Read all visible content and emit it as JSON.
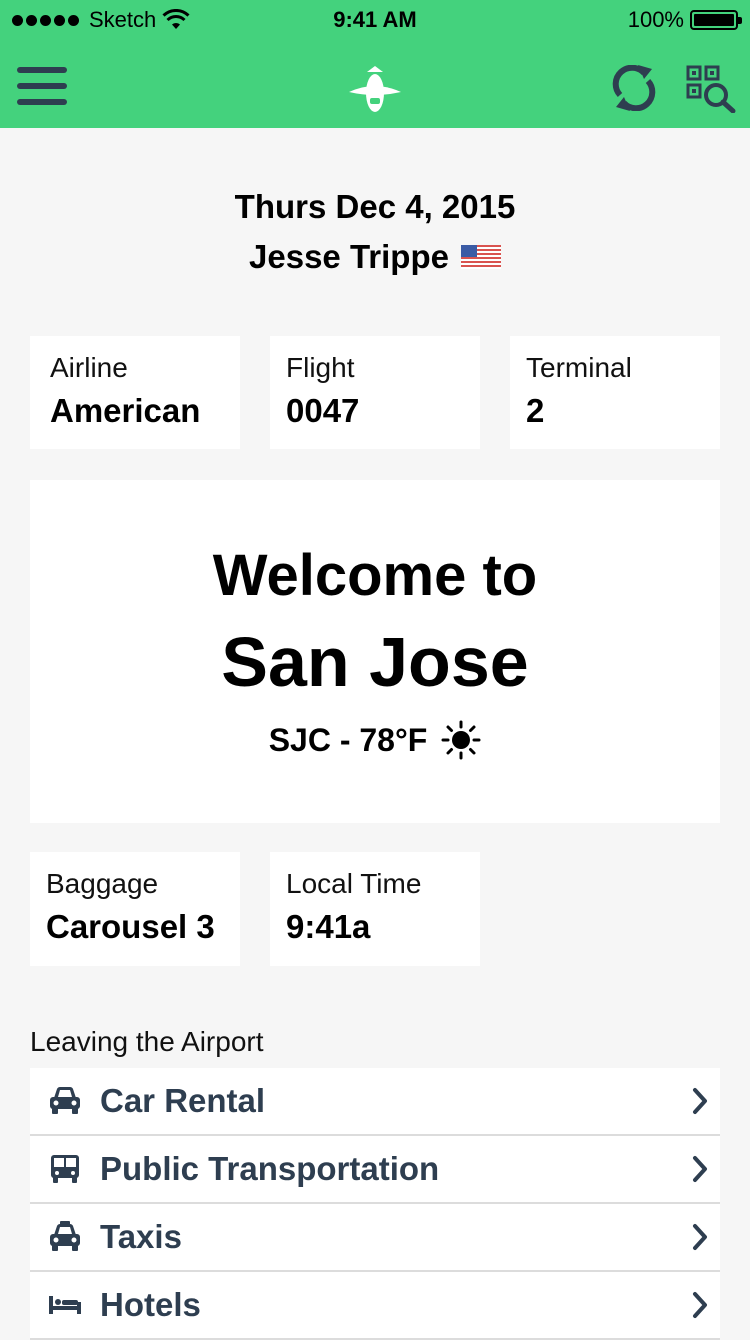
{
  "status_bar": {
    "carrier": "Sketch",
    "time": "9:41 AM",
    "battery_percent": "100%"
  },
  "navbar": {
    "menu_icon": "hamburger-icon",
    "logo_icon": "plane-icon",
    "refresh_icon": "refresh-icon",
    "scan_icon": "qr-search-icon"
  },
  "header": {
    "date": "Thurs Dec 4, 2015",
    "name": "Jesse Trippe",
    "flag": "us-flag"
  },
  "flight_info": [
    {
      "label": "Airline",
      "value": "American"
    },
    {
      "label": "Flight",
      "value": "0047"
    },
    {
      "label": "Terminal",
      "value": "2"
    }
  ],
  "welcome": {
    "line1": "Welcome to",
    "city": "San Jose",
    "weather": "SJC - 78°F",
    "weather_icon": "sun-icon"
  },
  "arrival_info": [
    {
      "label": "Baggage",
      "value": "Carousel 3"
    },
    {
      "label": "Local Time",
      "value": "9:41a"
    }
  ],
  "leaving": {
    "title": "Leaving the Airport",
    "items": [
      {
        "label": "Car Rental",
        "icon": "car-icon"
      },
      {
        "label": "Public Transportation",
        "icon": "bus-icon"
      },
      {
        "label": "Taxis",
        "icon": "taxi-icon"
      },
      {
        "label": "Hotels",
        "icon": "bed-icon"
      }
    ]
  },
  "colors": {
    "accent": "#44d27d",
    "icon_dark": "#2e3e50",
    "background": "#f6f6f6"
  }
}
